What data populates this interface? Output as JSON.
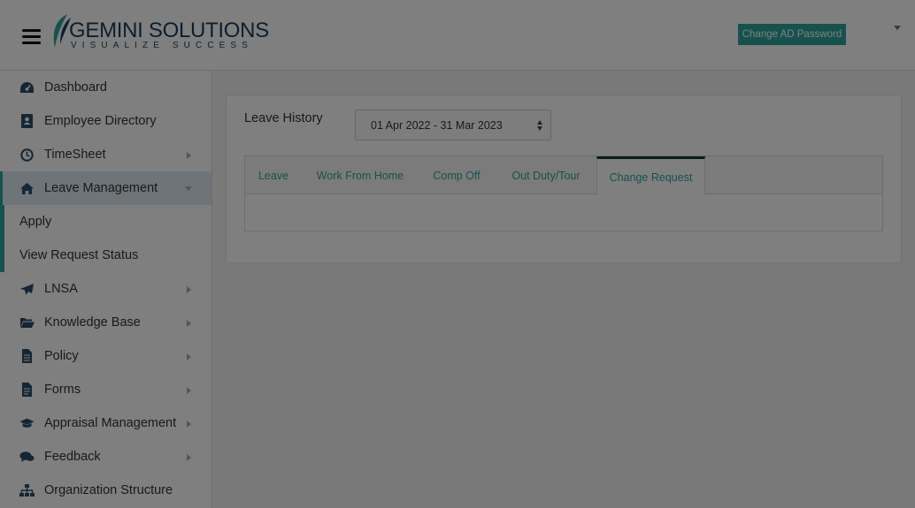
{
  "header": {
    "logo_text": "GEMINI SOLUTIONS",
    "logo_tagline": "VISUALIZE SUCCESS",
    "change_password_label": "Change AD Password"
  },
  "sidebar": {
    "items": [
      {
        "label": "Dashboard",
        "icon": "dashboard-icon"
      },
      {
        "label": "Employee Directory",
        "icon": "address-book-icon"
      },
      {
        "label": "TimeSheet",
        "icon": "clock-icon"
      },
      {
        "label": "Leave Management",
        "icon": "home-icon"
      },
      {
        "label": "LNSA",
        "icon": "paper-plane-icon"
      },
      {
        "label": "Knowledge Base",
        "icon": "folder-open-icon"
      },
      {
        "label": "Policy",
        "icon": "file-icon"
      },
      {
        "label": "Forms",
        "icon": "file-text-icon"
      },
      {
        "label": "Appraisal Management",
        "icon": "graduation-cap-icon"
      },
      {
        "label": "Feedback",
        "icon": "comments-icon"
      },
      {
        "label": "Organization Structure",
        "icon": "sitemap-icon"
      }
    ],
    "sub_items": [
      {
        "label": "Apply"
      },
      {
        "label": "View Request Status"
      }
    ]
  },
  "main": {
    "leave_history_label": "Leave History",
    "period_select_value": "01 Apr 2022 - 31 Mar 2023",
    "tabs": [
      {
        "label": "Leave"
      },
      {
        "label": "Work From Home"
      },
      {
        "label": "Comp Off"
      },
      {
        "label": "Out Duty/Tour"
      },
      {
        "label": "Change Request"
      }
    ]
  },
  "colors": {
    "accent": "#2aa59a",
    "brand_text": "#1a3d5c",
    "active_tab_border": "#0f3a3a"
  }
}
